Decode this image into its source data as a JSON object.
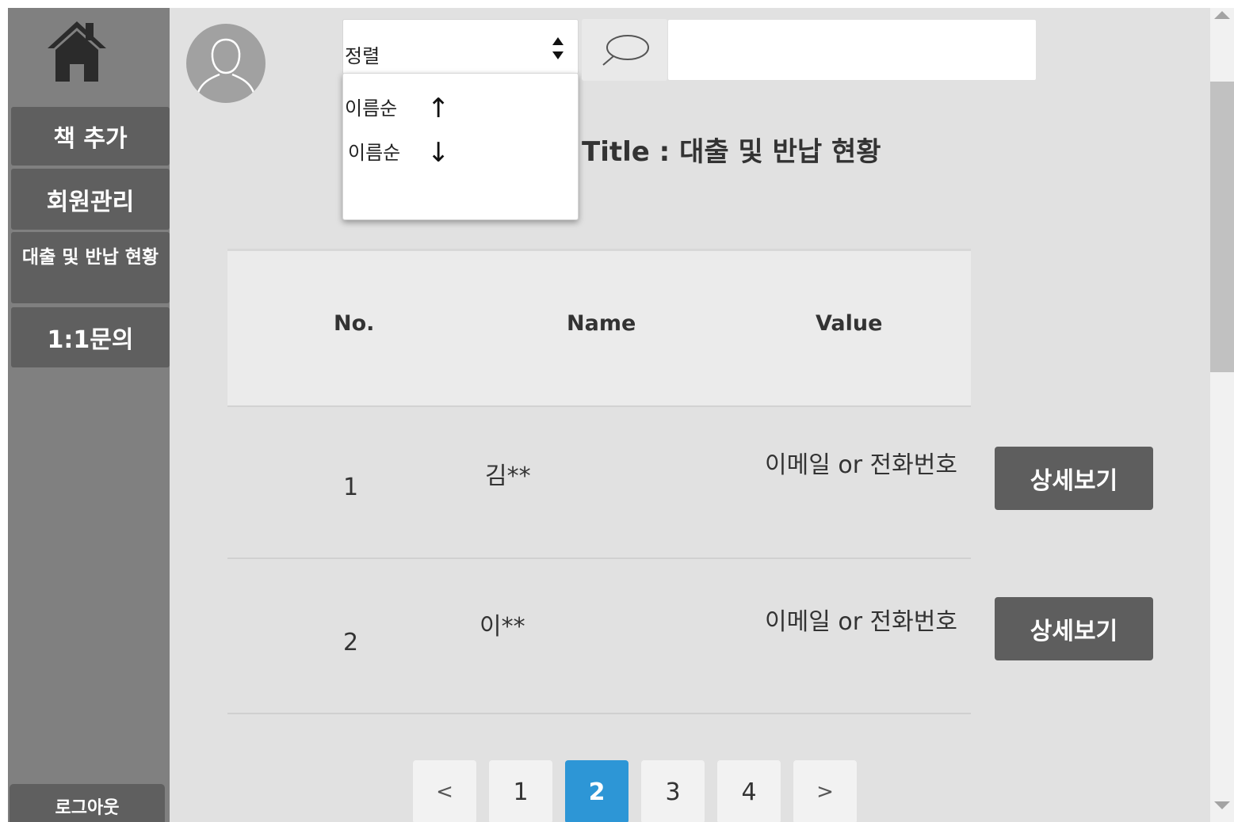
{
  "sidebar": {
    "home_icon": "home-icon",
    "items": [
      {
        "label": "책 추가"
      },
      {
        "label": "회원관리"
      },
      {
        "label": "대출 및 반납 현황"
      },
      {
        "label": "1:1문의"
      }
    ],
    "logout_label": "로그아웃"
  },
  "toolbar": {
    "avatar_icon": "user-avatar-icon",
    "sort": {
      "selected": "정렬",
      "options": [
        {
          "label": "이름순",
          "arrow": "↑"
        },
        {
          "label": "이름순",
          "arrow": "↓"
        }
      ]
    },
    "search_icon": "search-icon",
    "search_value": ""
  },
  "page": {
    "title": "Title : 대출 및 반납 현황"
  },
  "table": {
    "columns": [
      "No.",
      "Name",
      "Value"
    ],
    "rows": [
      {
        "no": "1",
        "name": "김**",
        "value": "이메일 or 전화번호",
        "action": "상세보기"
      },
      {
        "no": "2",
        "name": "이**",
        "value": "이메일 or 전화번호",
        "action": "상세보기"
      }
    ]
  },
  "pagination": {
    "prev": "<",
    "pages": [
      "1",
      "2",
      "3",
      "4"
    ],
    "current": "2",
    "next": ">"
  },
  "colors": {
    "sidebar_bg": "#808080",
    "sidebar_button": "#5f5f5f",
    "content_bg": "#e1e1e1",
    "accent": "#2d96d6",
    "detail_button": "#5e5e5e"
  }
}
